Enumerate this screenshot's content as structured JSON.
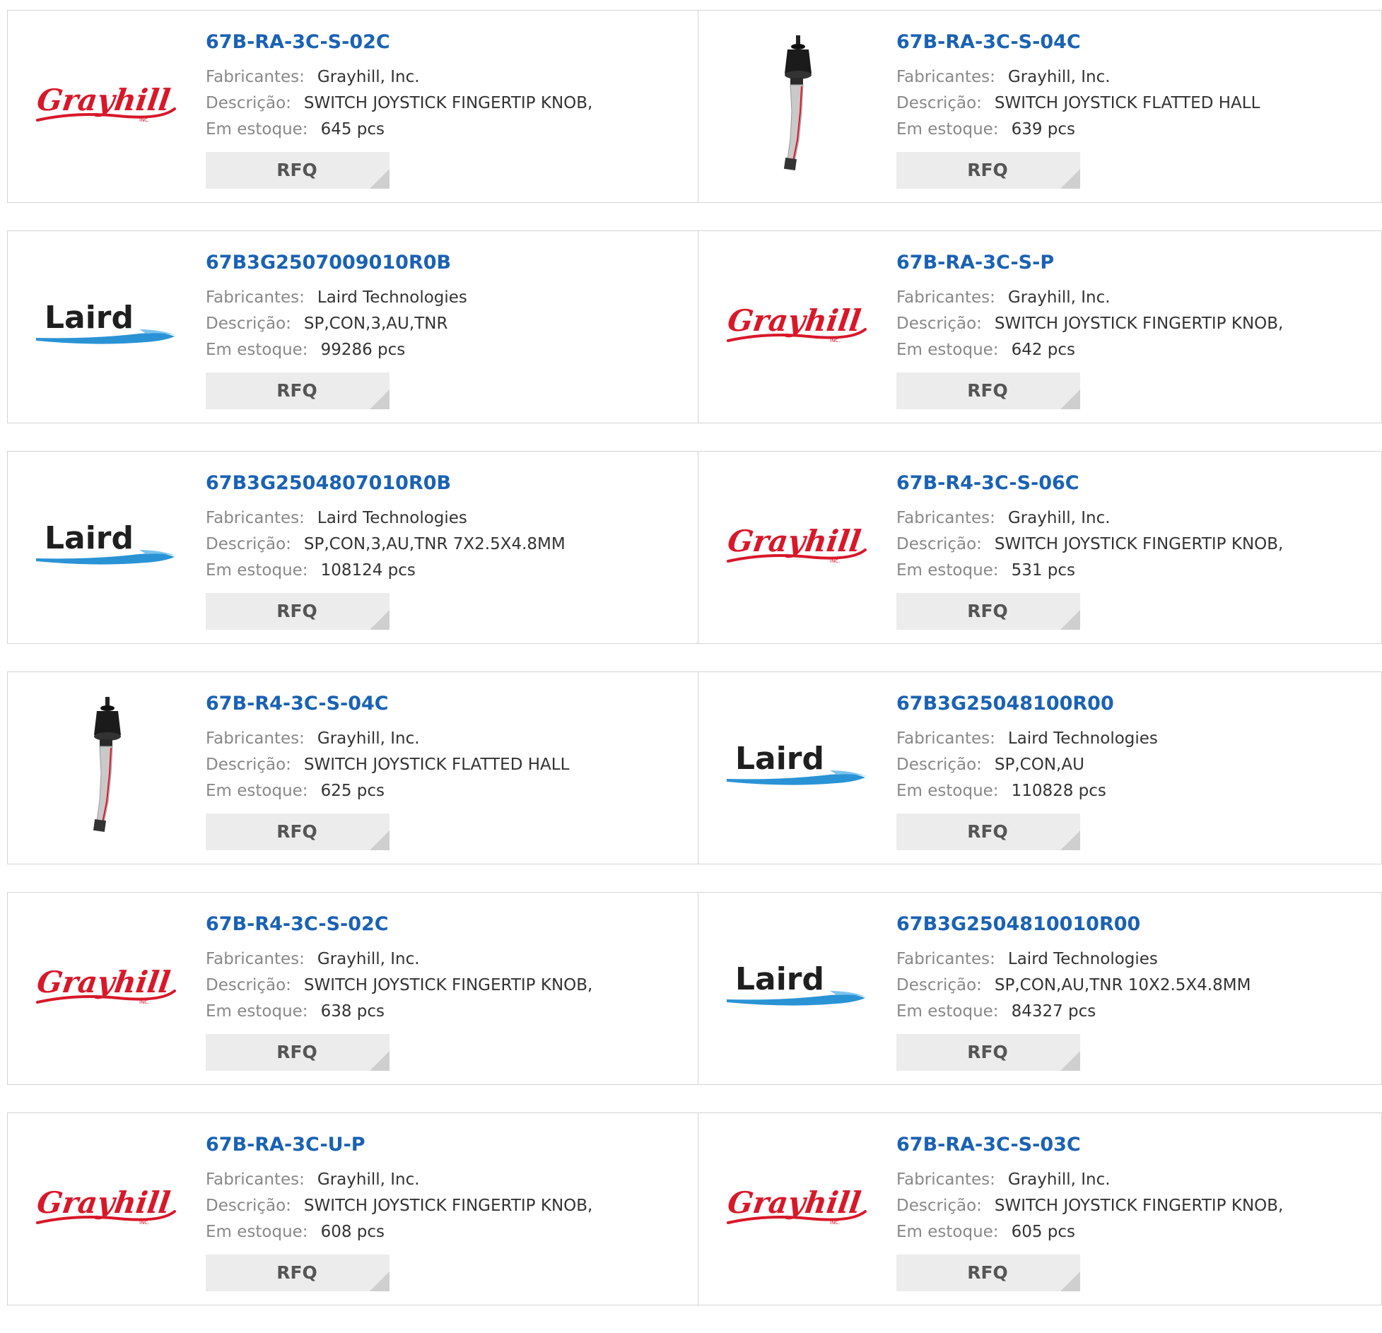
{
  "labels": {
    "manufacturer": "Fabricantes:",
    "description": "Descrição:",
    "stock": "Em estoque:",
    "rfq": "RFQ"
  },
  "logos": {
    "grayhill": "Grayhill",
    "grayhill_sub": "INC.",
    "laird": "Laird"
  },
  "colors": {
    "part_link": "#1a62b3",
    "grayhill_red": "#d8182a",
    "laird_blue": "#2a93d5"
  },
  "products": [
    {
      "part": "67B-RA-3C-S-02C",
      "manufacturer": "Grayhill, Inc.",
      "description": "SWITCH JOYSTICK FINGERTIP KNOB,",
      "stock": "645 pcs",
      "image": "grayhill-logo"
    },
    {
      "part": "67B-RA-3C-S-04C",
      "manufacturer": "Grayhill, Inc.",
      "description": "SWITCH JOYSTICK FLATTED HALL",
      "stock": "639 pcs",
      "image": "joystick-photo"
    },
    {
      "part": "67B3G2507009010R0B",
      "manufacturer": "Laird Technologies",
      "description": "SP,CON,3,AU,TNR",
      "stock": "99286 pcs",
      "image": "laird-logo"
    },
    {
      "part": "67B-RA-3C-S-P",
      "manufacturer": "Grayhill, Inc.",
      "description": "SWITCH JOYSTICK FINGERTIP KNOB,",
      "stock": "642 pcs",
      "image": "grayhill-logo"
    },
    {
      "part": "67B3G2504807010R0B",
      "manufacturer": "Laird Technologies",
      "description": "SP,CON,3,AU,TNR 7X2.5X4.8MM",
      "stock": "108124 pcs",
      "image": "laird-logo"
    },
    {
      "part": "67B-R4-3C-S-06C",
      "manufacturer": "Grayhill, Inc.",
      "description": "SWITCH JOYSTICK FINGERTIP KNOB,",
      "stock": "531 pcs",
      "image": "grayhill-logo"
    },
    {
      "part": "67B-R4-3C-S-04C",
      "manufacturer": "Grayhill, Inc.",
      "description": "SWITCH JOYSTICK FLATTED HALL",
      "stock": "625 pcs",
      "image": "joystick-photo"
    },
    {
      "part": "67B3G25048100R00",
      "manufacturer": "Laird Technologies",
      "description": "SP,CON,AU",
      "stock": "110828 pcs",
      "image": "laird-logo"
    },
    {
      "part": "67B-R4-3C-S-02C",
      "manufacturer": "Grayhill, Inc.",
      "description": "SWITCH JOYSTICK FINGERTIP KNOB,",
      "stock": "638 pcs",
      "image": "grayhill-logo"
    },
    {
      "part": "67B3G2504810010R00",
      "manufacturer": "Laird Technologies",
      "description": "SP,CON,AU,TNR 10X2.5X4.8MM",
      "stock": "84327 pcs",
      "image": "laird-logo"
    },
    {
      "part": "67B-RA-3C-U-P",
      "manufacturer": "Grayhill, Inc.",
      "description": "SWITCH JOYSTICK FINGERTIP KNOB,",
      "stock": "608 pcs",
      "image": "grayhill-logo"
    },
    {
      "part": "67B-RA-3C-S-03C",
      "manufacturer": "Grayhill, Inc.",
      "description": "SWITCH JOYSTICK FINGERTIP KNOB,",
      "stock": "605 pcs",
      "image": "grayhill-logo"
    }
  ]
}
